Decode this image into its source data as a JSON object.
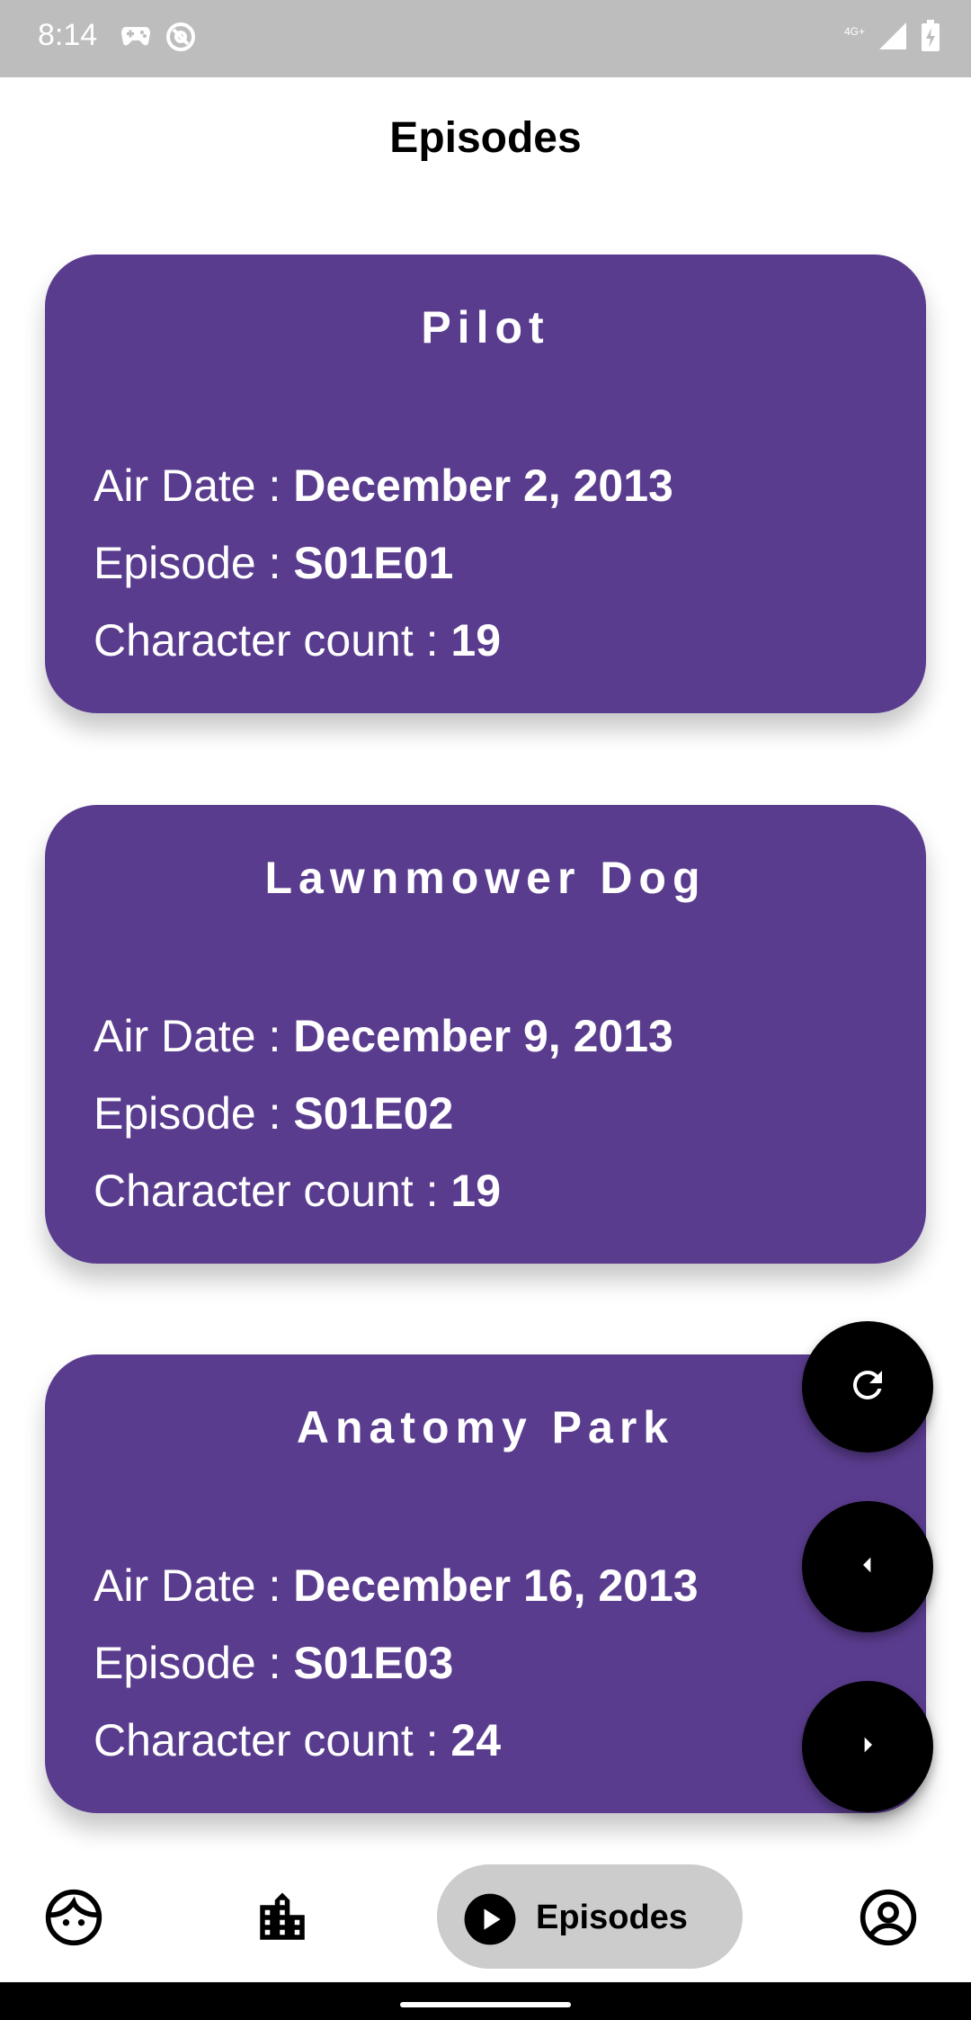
{
  "status_bar": {
    "time": "8:14",
    "network": "4G+",
    "left_icons": [
      "gamepad-icon",
      "at-icon"
    ],
    "right_icons": [
      "signal-icon",
      "battery-charging-icon"
    ]
  },
  "header": {
    "title": "Episodes"
  },
  "episodes": [
    {
      "name": "Pilot",
      "air_date_label": "Air Date : ",
      "air_date": "December 2, 2013",
      "episode_label": "Episode : ",
      "episode": "S01E01",
      "count_label": "Character count : ",
      "count": "19"
    },
    {
      "name": "Lawnmower Dog",
      "air_date_label": "Air Date : ",
      "air_date": "December 9, 2013",
      "episode_label": "Episode : ",
      "episode": "S01E02",
      "count_label": "Character count : ",
      "count": "19"
    },
    {
      "name": "Anatomy Park",
      "air_date_label": "Air Date : ",
      "air_date": "December 16, 2013",
      "episode_label": "Episode : ",
      "episode": "S01E03",
      "count_label": "Character count : ",
      "count": "24"
    }
  ],
  "fabs": [
    "refresh-icon",
    "previous-page-icon",
    "next-page-icon"
  ],
  "bottom_nav": {
    "items": [
      {
        "icon": "face-icon"
      },
      {
        "icon": "city-icon"
      },
      {
        "icon": "play-icon",
        "label": "Episodes",
        "active": true
      },
      {
        "icon": "account-icon"
      }
    ]
  },
  "colors": {
    "card": "#5a3c8e",
    "status_bar": "#bdbdbd",
    "active_nav": "#cccccc",
    "fab": "#000000"
  }
}
